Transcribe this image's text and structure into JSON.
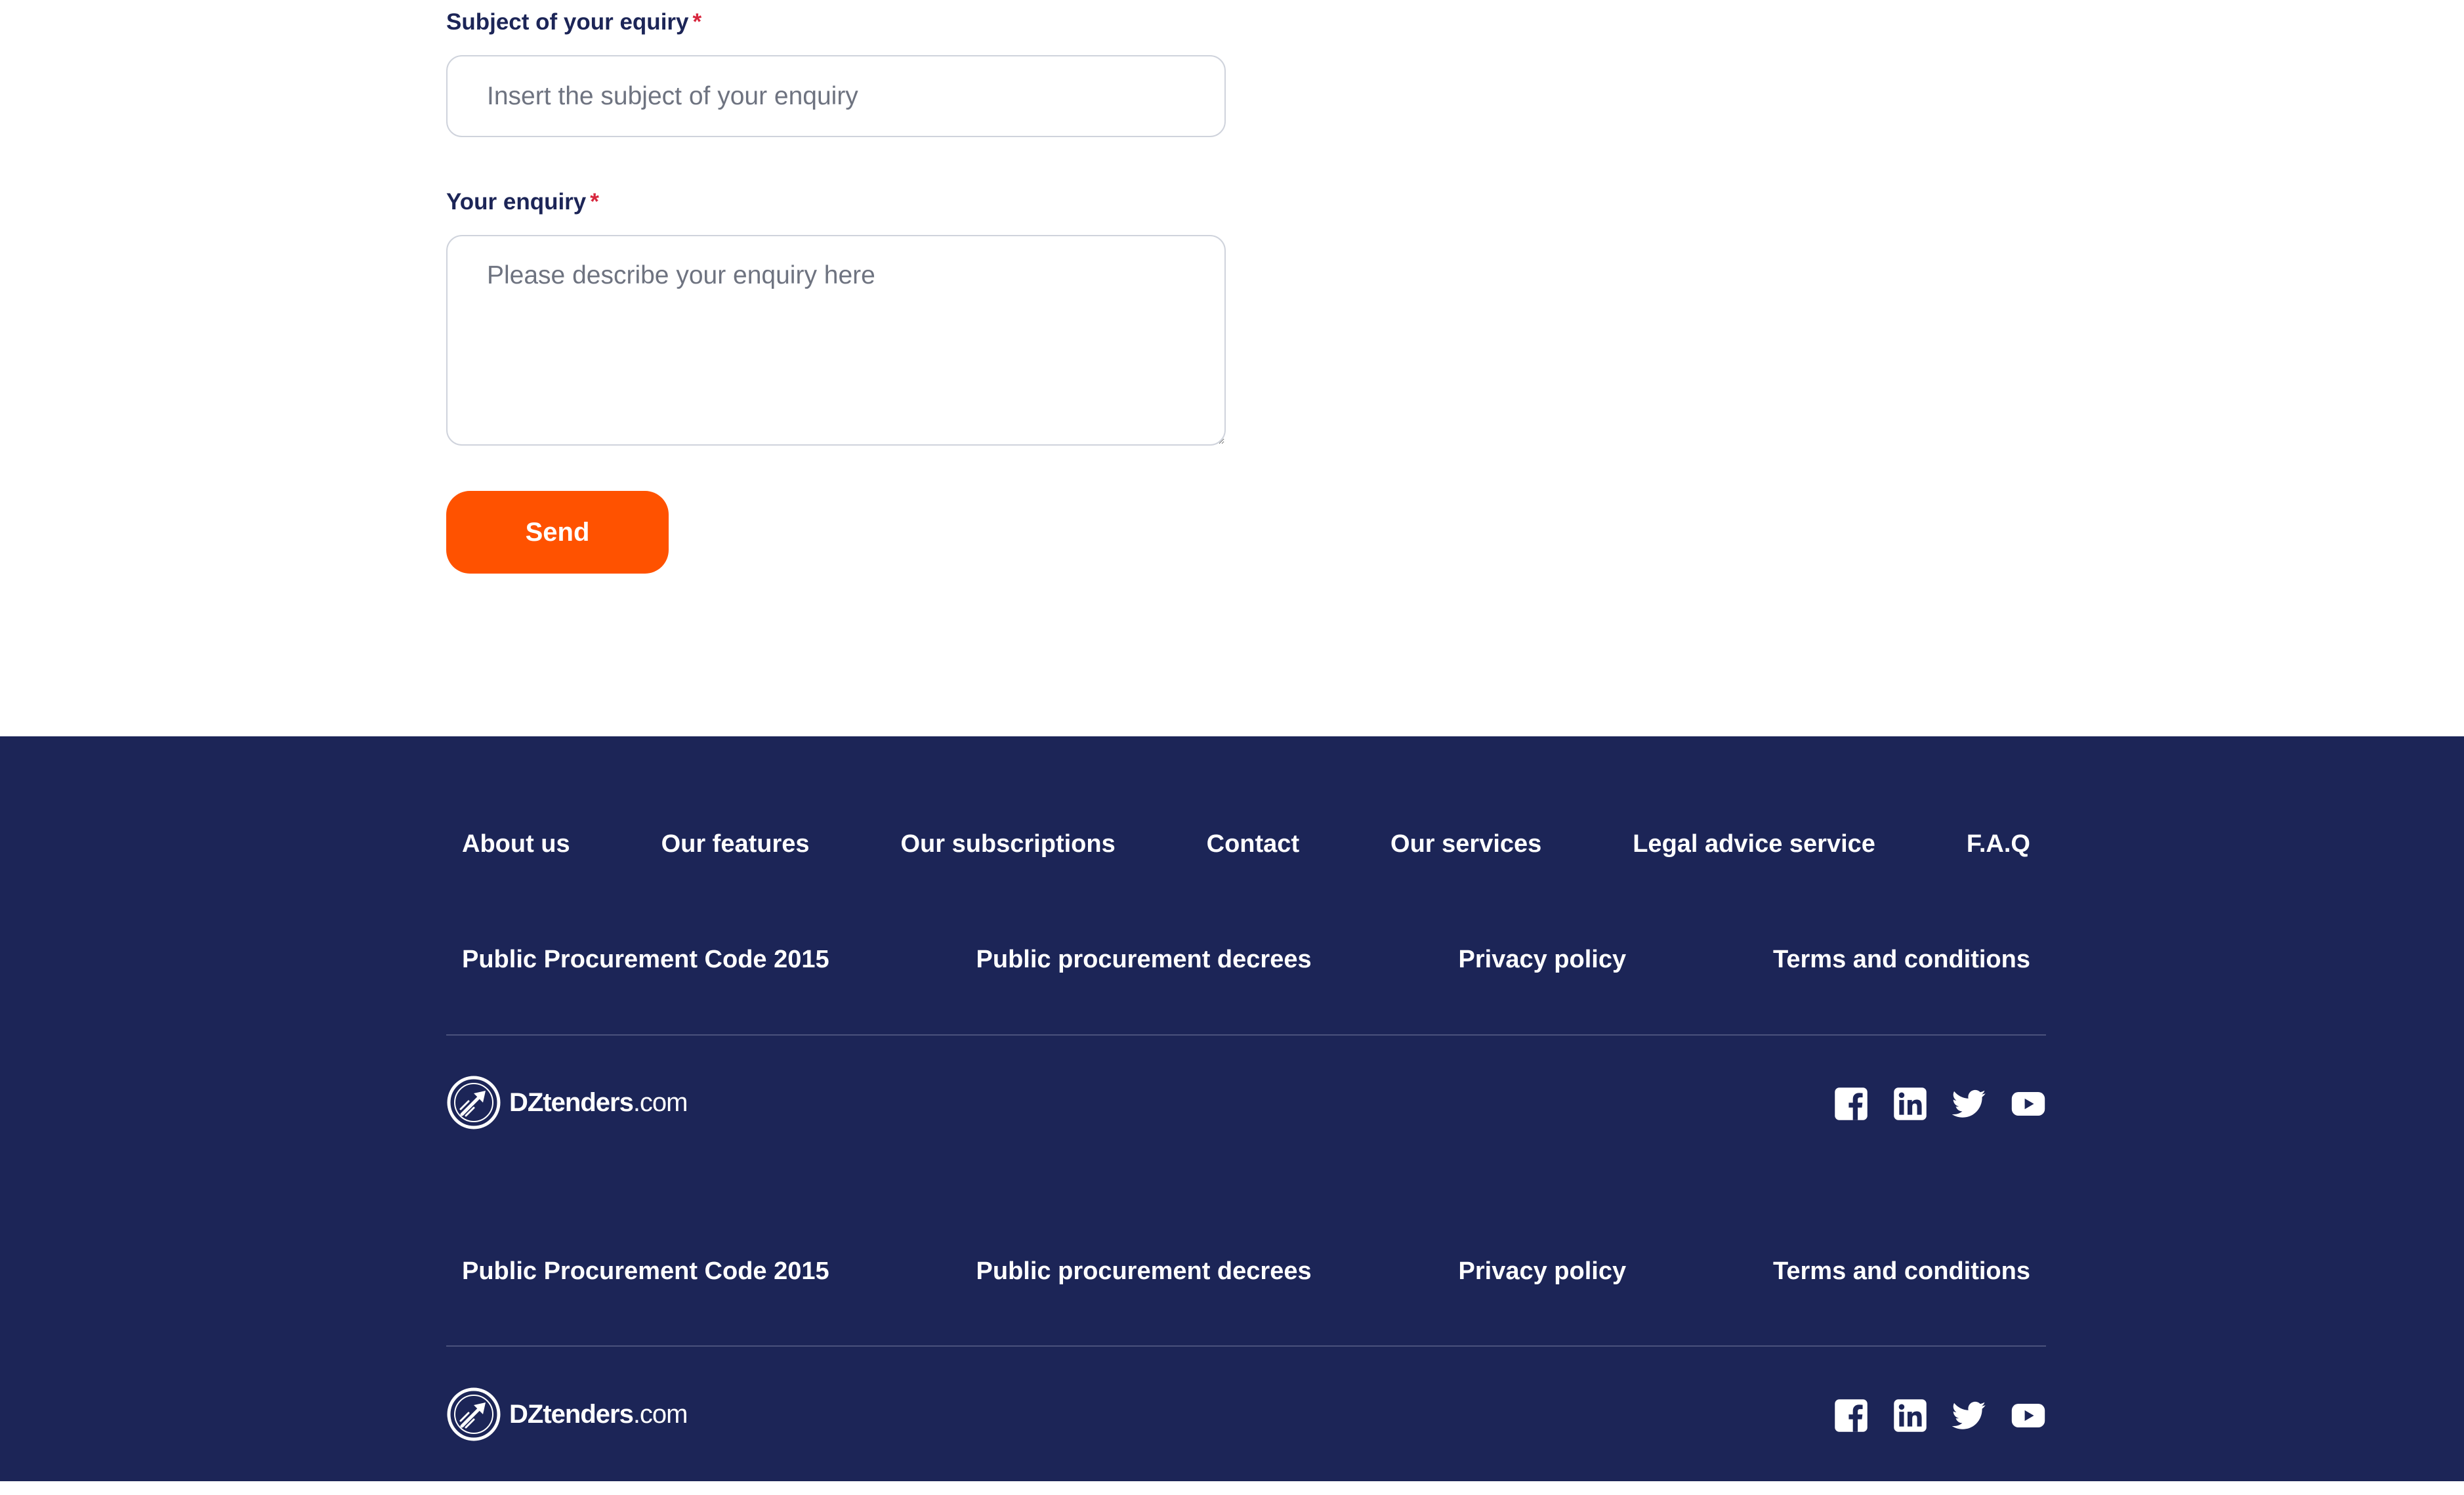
{
  "form": {
    "subject_label": "Subject of your equiry",
    "subject_required": "*",
    "subject_placeholder": "Insert the subject of your enquiry",
    "enquiry_label": "Your enquiry",
    "enquiry_required": "*",
    "enquiry_placeholder": "Please describe your enquiry here",
    "send_label": "Send"
  },
  "footer": {
    "nav": [
      {
        "label": "About us"
      },
      {
        "label": "Our features"
      },
      {
        "label": "Our subscriptions"
      },
      {
        "label": "Contact"
      },
      {
        "label": "Our services"
      },
      {
        "label": "Legal advice service"
      },
      {
        "label": "F.A.Q"
      }
    ],
    "legal": [
      {
        "label": "Public Procurement Code 2015"
      },
      {
        "label": "Public procurement decrees"
      },
      {
        "label": "Privacy policy"
      },
      {
        "label": "Terms and conditions"
      }
    ],
    "logo": {
      "brand": "DZtenders",
      "suffix": ".com"
    },
    "social_icons": [
      "facebook-icon",
      "linkedin-icon",
      "twitter-icon",
      "youtube-icon"
    ]
  },
  "colors": {
    "navy": "#1c2557",
    "accent": "#ff5200",
    "required": "#d7263d",
    "border": "#cfd3dc"
  }
}
